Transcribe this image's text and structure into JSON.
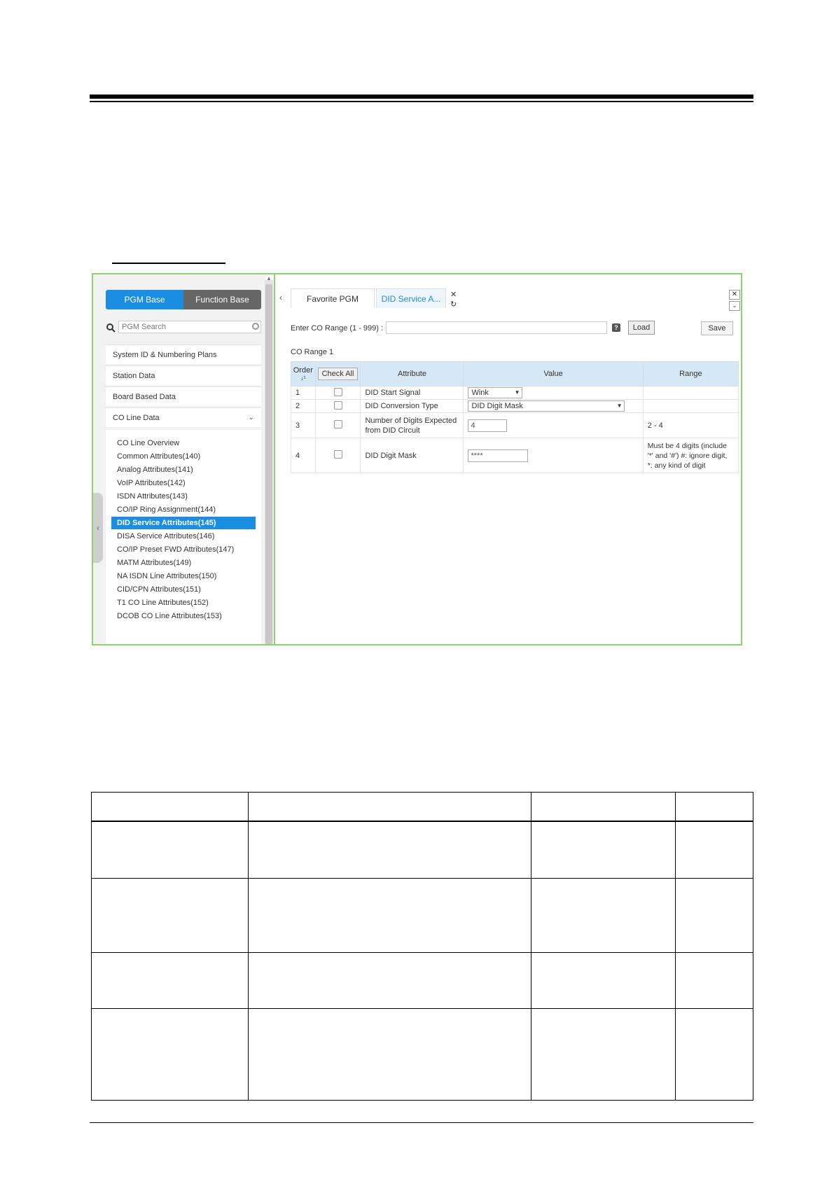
{
  "left_panel": {
    "toggle": {
      "pgm_base": "PGM Base",
      "function_base": "Function Base"
    },
    "search_placeholder": "PGM Search",
    "nav_items": [
      "System ID & Numbering Plans",
      "Station Data",
      "Board Based Data",
      "CO Line Data"
    ],
    "sub_items": [
      "CO Line Overview",
      "Common Attributes(140)",
      "Analog Attributes(141)",
      "VoIP Attributes(142)",
      "ISDN Attributes(143)",
      "CO/IP Ring Assignment(144)",
      "DID Service Attributes(145)",
      "DISA Service Attributes(146)",
      "CO/IP Preset FWD Attributes(147)",
      "MATM Attributes(149)",
      "NA ISDN Line Attributes(150)",
      "CID/CPN Attributes(151)",
      "T1 CO Line Attributes(152)",
      "DCOB CO Line Attributes(153)"
    ]
  },
  "tabs": {
    "favorite": "Favorite PGM",
    "active": "DID Service A..."
  },
  "form": {
    "range_label": "Enter CO Range (1 - 999) :",
    "load": "Load",
    "save": "Save",
    "co_range": "CO Range 1"
  },
  "grid": {
    "headers": {
      "order": "Order",
      "check_all": "Check All",
      "attribute": "Attribute",
      "value": "Value",
      "range": "Range"
    },
    "rows": [
      {
        "order": "1",
        "attribute": "DID Start Signal",
        "value": "Wink",
        "range": ""
      },
      {
        "order": "2",
        "attribute": "DID Conversion Type",
        "value": "DID Digit Mask",
        "range": ""
      },
      {
        "order": "3",
        "attribute": "Number of Digits Expected from DID Circuit",
        "value": "4",
        "range": "2 - 4"
      },
      {
        "order": "4",
        "attribute": "DID Digit Mask",
        "value": "****",
        "range": "Must be 4 digits (include '*' and '#') #: ignore digit, *: any kind of digit"
      }
    ]
  },
  "colors": {
    "accent": "#1a8ee0",
    "frame": "#8fd16a",
    "grid_header": "#d6e8f5"
  }
}
